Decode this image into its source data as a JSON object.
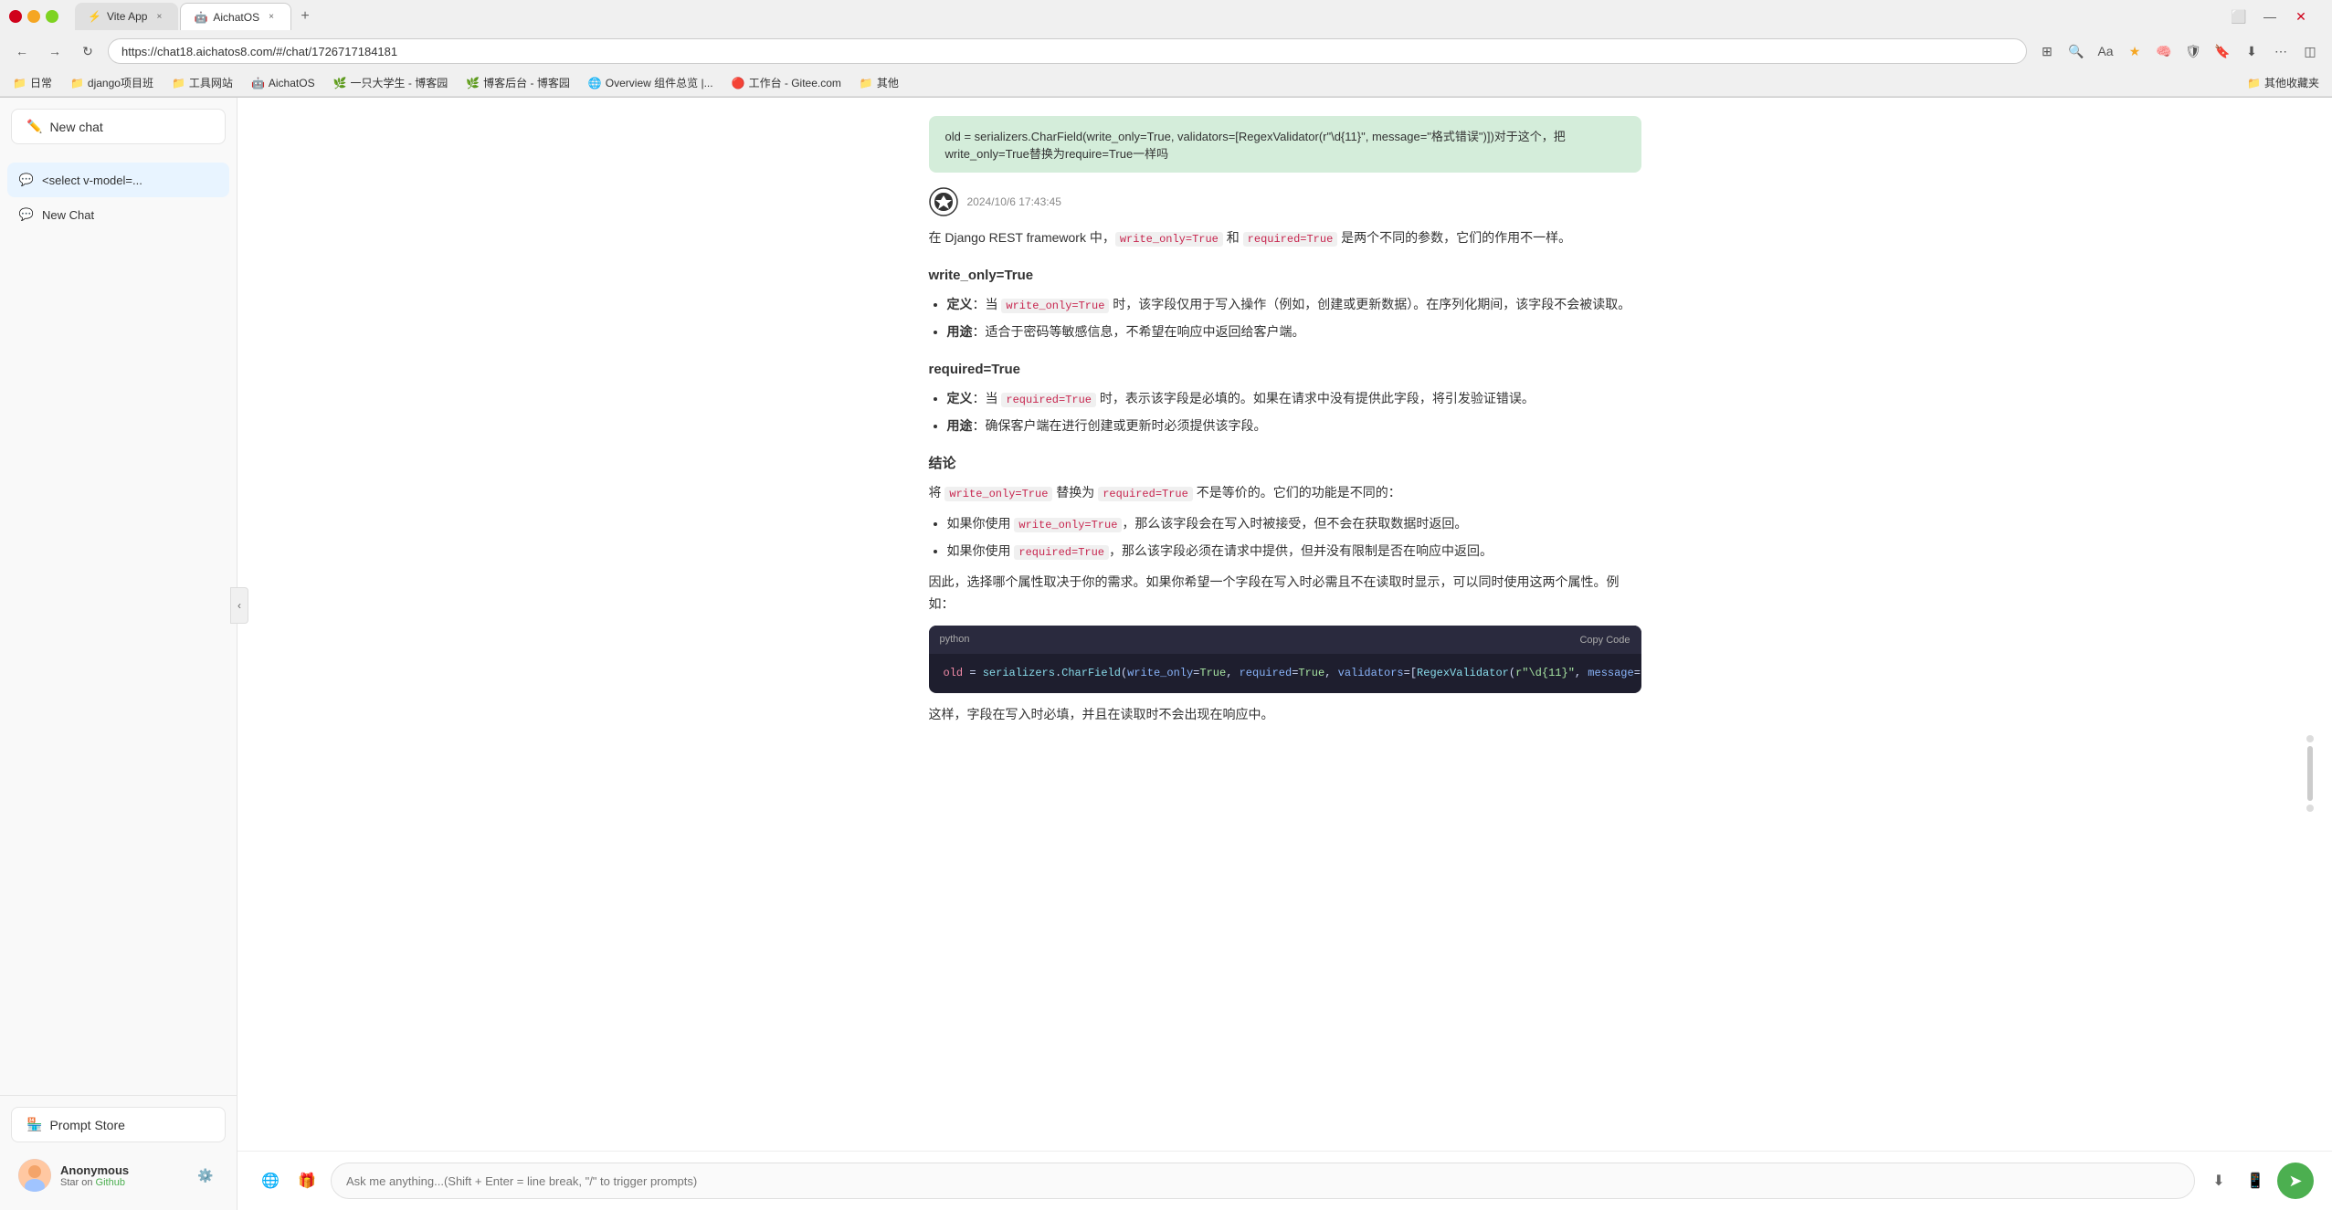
{
  "browser": {
    "url": "https://chat18.aichatos8.com/#/chat/1726717184181",
    "tabs": [
      {
        "label": "Vite App",
        "favicon": "⚡",
        "active": false
      },
      {
        "label": "AichatOS",
        "favicon": "🤖",
        "active": true
      }
    ],
    "bookmarks": [
      {
        "label": "日常",
        "icon": "📁"
      },
      {
        "label": "django项目班",
        "icon": "📁"
      },
      {
        "label": "工具网站",
        "icon": "📁"
      },
      {
        "label": "AichatOS",
        "icon": "🤖"
      },
      {
        "label": "一只大学生 - 博客园",
        "icon": "🌿"
      },
      {
        "label": "博客后台 - 博客园",
        "icon": "🌿"
      },
      {
        "label": "Overview 组件总览 |...",
        "icon": "🌐"
      },
      {
        "label": "工作台 - Gitee.com",
        "icon": "🔴"
      },
      {
        "label": "其他",
        "icon": "📁"
      },
      {
        "label": "其他收藏夹",
        "icon": "📁"
      }
    ]
  },
  "sidebar": {
    "new_chat_label": "New chat",
    "chats": [
      {
        "id": "chat1",
        "label": "<select v-model=...",
        "active": true
      },
      {
        "id": "chat2",
        "label": "New Chat",
        "active": false
      }
    ],
    "prompt_store_label": "Prompt Store",
    "user": {
      "name": "Anonymous",
      "sub": "Star on Github",
      "sub_link": "Github"
    }
  },
  "chat": {
    "user_message": "old = serializers.CharField(write_only=True, validators=[RegexValidator(r\"\\d{11}\", message=\"格式错误\")])对于这个，把write_only=True替换为require=True一样吗",
    "ai_timestamp": "2024/10/6 17:43:45",
    "response": {
      "intro": "在 Django REST framework 中，write_only=True 和 required=True 是两个不同的参数，它们的作用不一样。",
      "section1_title": "write_only=True",
      "section1_items": [
        {
          "label": "定义",
          "text": "：当 write_only=True 时，该字段仅用于写入操作（例如，创建或更新数据）。在序列化期间，该字段不会被读取。"
        },
        {
          "label": "用途",
          "text": "：适合于密码等敏感信息，不希望在响应中返回给客户端。"
        }
      ],
      "section2_title": "required=True",
      "section2_items": [
        {
          "label": "定义",
          "text": "：当 required=True 时，表示该字段是必填的。如果在请求中没有提供此字段，将引发验证错误。"
        },
        {
          "label": "用途",
          "text": "：确保客户端在进行创建或更新时必须提供该字段。"
        }
      ],
      "conclusion_title": "结论",
      "conclusion_text": "将 write_only=True 替换为 required=True 不是等价的。它们的功能是不同的：",
      "conclusion_items": [
        "如果你使用 write_only=True，那么该字段会在写入时被接受，但不会在获取数据时返回。",
        "如果你使用 required=True，那么该字段必须在请求中提供，但并没有限制是否在响应中返回。"
      ],
      "final_text": "因此，选择哪个属性取决于你的需求。如果你希望一个字段在写入时必需且不在读取时显示，可以同时使用这两个属性。例如：",
      "code": {
        "lang": "python",
        "copy_label": "Copy Code",
        "content": "old = serializers.CharField(write_only=True, required=True, validators=[RegexValidator(r\"\\d{11}\", message=\"格式错误\")])"
      },
      "after_code": "这样，字段在写入时必填，并且在读取时不会出现在响应中。"
    }
  },
  "input": {
    "placeholder": "Ask me anything...(Shift + Enter = line break, \"/\" to trigger prompts)"
  },
  "icons": {
    "new_chat": "✏️",
    "chat_bubble": "💬",
    "prompt_store": "🏪",
    "gear": "⚙️",
    "globe": "🌐",
    "gift": "🎁",
    "download": "⬇",
    "share": "📱",
    "send": "➤",
    "back": "←",
    "forward": "→",
    "refresh": "↻",
    "collapse": "‹",
    "edit": "✎",
    "delete": "🗑",
    "ai_logo": "✦"
  }
}
